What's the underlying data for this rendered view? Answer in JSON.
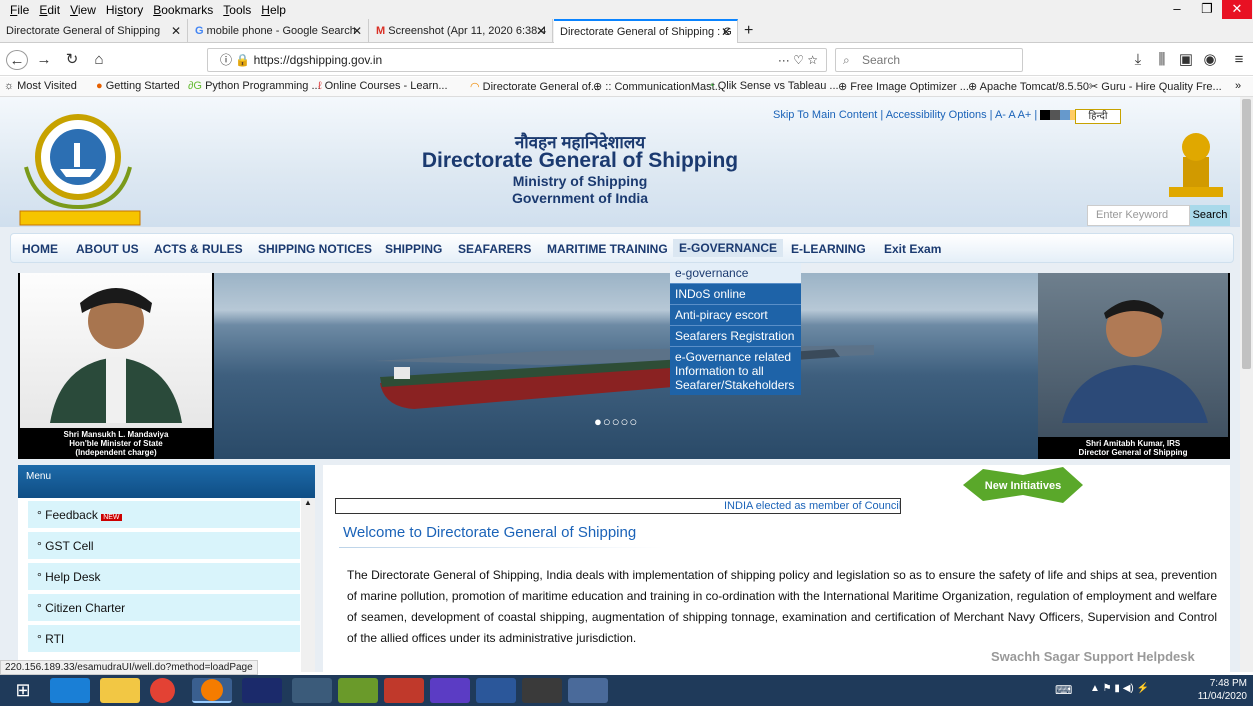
{
  "menubar": {
    "items": [
      "File",
      "Edit",
      "View",
      "History",
      "Bookmarks",
      "Tools",
      "Help"
    ],
    "underline": [
      "F",
      "E",
      "V",
      "s",
      "B",
      "T",
      "H"
    ]
  },
  "tabs": [
    {
      "label": "Directorate General of Shipping"
    },
    {
      "label": "mobile phone - Google Search"
    },
    {
      "label": "Screenshot (Apr 11, 2020 6:38:4"
    },
    {
      "label": "Directorate General of Shipping : G"
    }
  ],
  "address": {
    "url": "https://dgshipping.gov.in",
    "search_placeholder": "Search",
    "more": "···"
  },
  "bookmarks": [
    "Most Visited",
    "Getting Started",
    "Python Programming ...",
    "Online Courses - Learn...",
    "Directorate General of...",
    ":: CommunicationMast...",
    "Qlik Sense vs Tableau ...",
    "Free Image Optimizer ...",
    "Apache Tomcat/8.5.50",
    "Guru - Hire Quality Fre..."
  ],
  "header": {
    "hindi_title": "नौवहन महानिदेशालय",
    "title": "Directorate General of Shipping",
    "ministry": "Ministry of Shipping",
    "govt": "Government of India",
    "toplinks": "Skip To Main Content | Accessibility Options | A- A A+ |",
    "hindi_button": "हिन्दी",
    "keyword_placeholder": "Enter Keyword",
    "search_button": "Search"
  },
  "nav": [
    "HOME",
    "ABOUT US",
    "ACTS & RULES",
    "SHIPPING NOTICES",
    "SHIPPING",
    "SEAFARERS",
    "MARITIME TRAINING",
    "E-GOVERNANCE",
    "E-LEARNING",
    "Exit Exam"
  ],
  "dropdown": [
    "e-governance",
    "INDoS online",
    "Anti-piracy escort",
    "Seafarers Registration",
    "e-Governance related Information to all Seafarer/Stakeholders"
  ],
  "banner": {
    "left_caption": [
      "Shri Mansukh L. Mandaviya",
      "Hon'ble Minister of State",
      "(Independent charge)"
    ],
    "right_caption": [
      "Shri Amitabh Kumar, IRS",
      "Director General of Shipping"
    ],
    "dots": "●○○○○"
  },
  "sidemenu": {
    "title": "Menu",
    "items": [
      "Feedback",
      "GST Cell",
      "Help Desk",
      "Citizen Charter",
      "RTI"
    ],
    "new_badge": "NEW"
  },
  "content": {
    "ticker": "INDIA elected as member of Council",
    "new_initiatives": "New Initiatives",
    "welcome": "Welcome to Directorate General of Shipping",
    "paragraph": "The Directorate General of Shipping, India deals with implementation of shipping policy and legislation so as to ensure the safety of life and ships at sea, prevention of marine pollution, promotion of maritime education and training in co-ordination with the International Maritime Organization, regulation of employment and welfare of seamen, development of coastal shipping, augmentation of shipping tonnage, examination and certification of Merchant Navy Officers, Supervision and Control of the allied offices under its administrative jurisdiction.",
    "helpdesk": "Swachh Sagar Support Helpdesk"
  },
  "status_url": "220.156.189.33/esamudraUI/well.do?method=loadPage",
  "clock": {
    "time": "7:48 PM",
    "date": "11/04/2020"
  }
}
